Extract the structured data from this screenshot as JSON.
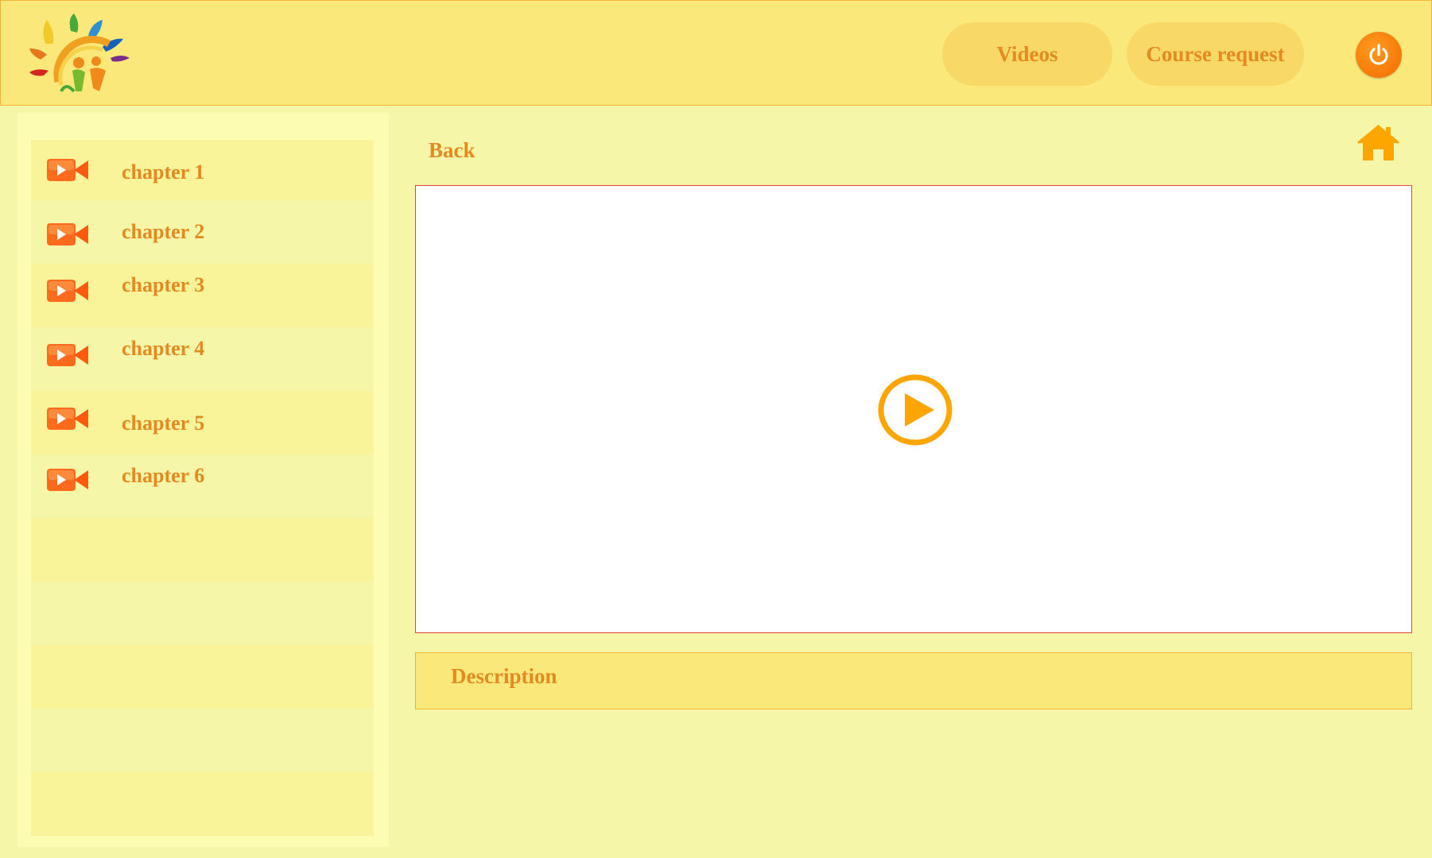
{
  "header": {
    "logo_icon": "sun-family-logo",
    "nav": [
      {
        "label": "Videos"
      },
      {
        "label": "Course request"
      }
    ],
    "power_icon": "power-icon"
  },
  "sidebar": {
    "chapters": [
      {
        "label": "chapter 1",
        "icon": "video-camera-icon"
      },
      {
        "label": "chapter 2",
        "icon": "video-camera-icon"
      },
      {
        "label": "chapter 3",
        "icon": "video-camera-icon"
      },
      {
        "label": "chapter 4",
        "icon": "video-camera-icon"
      },
      {
        "label": "chapter 5",
        "icon": "video-camera-icon"
      },
      {
        "label": "chapter 6",
        "icon": "video-camera-icon"
      }
    ],
    "empty_rows": 5
  },
  "main": {
    "back_label": "Back",
    "home_icon": "home-icon",
    "player_icon": "play-icon",
    "description_label": "Description"
  },
  "colors": {
    "accent": "#e48a20",
    "header_bg": "#fae97a",
    "page_bg": "#f6f6a8",
    "icon_orange": "#ffa500",
    "player_border": "#e8433b"
  }
}
